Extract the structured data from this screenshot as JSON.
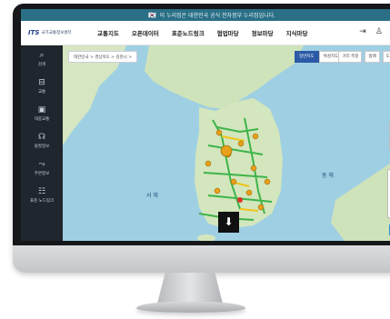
{
  "banner": {
    "flag": "🇰🇷",
    "text": "이 누리집은 대한민국 공식 전자정부 누리집입니다."
  },
  "header": {
    "logo_mark": "ITS",
    "logo_text": "국가교통정보센터",
    "nav": [
      "교통지도",
      "오픈데이터",
      "표준노드링크",
      "협업마당",
      "정보마당",
      "지식마당"
    ],
    "icons": [
      "login-icon",
      "user-icon",
      "menu-icon"
    ]
  },
  "sidebar": {
    "items": [
      {
        "icon": "search-icon",
        "label": "검색"
      },
      {
        "icon": "traffic-icon",
        "label": "교통"
      },
      {
        "icon": "bus-icon",
        "label": "대중교통"
      },
      {
        "icon": "cctv-icon",
        "label": "돌발정보"
      },
      {
        "icon": "route-icon",
        "label": "주변정보"
      },
      {
        "icon": "list-icon",
        "label": "표준 노드링크"
      }
    ]
  },
  "map": {
    "breadcrumb": "대한민국 > 경상북도 > 김천시 >",
    "maptype": [
      "일반지도",
      "위성지도"
    ],
    "top_right": [
      "거리 측정",
      "범례",
      "도움"
    ],
    "zoom": [
      "+",
      "−"
    ],
    "labels": [
      "동 해",
      "서 해"
    ],
    "down_button": "⬇",
    "colors": {
      "land": "#cfe3ba",
      "sea": "#9fcfe3",
      "road_green": "#3eb44a",
      "road_yellow": "#f2c418",
      "road_red": "#e0332b"
    }
  }
}
